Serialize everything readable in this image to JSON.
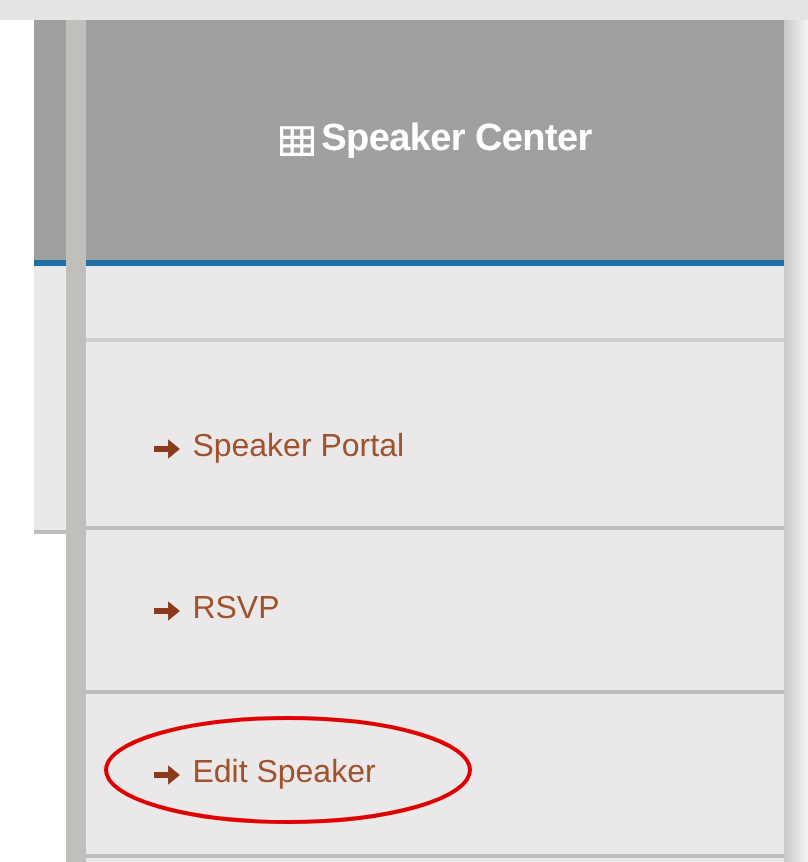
{
  "panel": {
    "title": "Speaker Center"
  },
  "links": [
    {
      "label": "Speaker Portal",
      "circled": false
    },
    {
      "label": "RSVP",
      "circled": false
    },
    {
      "label": "Edit Speaker",
      "circled": true
    }
  ]
}
